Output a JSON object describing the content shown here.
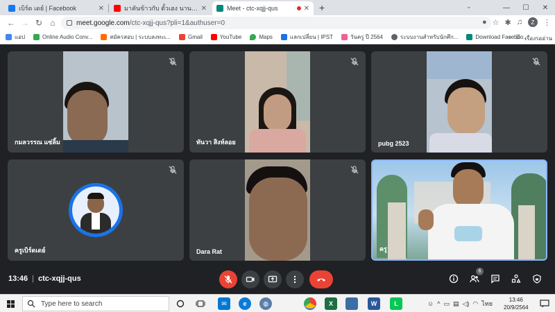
{
  "browser": {
    "tabs": [
      {
        "title": "เบิร์ด เดย์ | Facebook",
        "favicon_color": "#1877f2",
        "active": false
      },
      {
        "title": "มาคันข้าวกับ ตั้วเฮง นานาวิ ประเทศ",
        "favicon_color": "#ff0000",
        "active": false
      },
      {
        "title": "Meet - ctc-xqjj-qus",
        "favicon_color": "#00897b",
        "active": true
      }
    ],
    "new_tab": "+",
    "window_controls": {
      "minimize": "—",
      "maximize": "☐",
      "close": "✕"
    },
    "url_host": "meet.google.com",
    "url_path": "/ctc-xqjj-qus?pli=1&authuser=0",
    "profile_initial": "Z",
    "bookmarks": [
      {
        "label": "แอป",
        "color": "#4285f4"
      },
      {
        "label": "Online Audio Conv...",
        "color": "#34a853"
      },
      {
        "label": "สมัครสอบ | ระบบลงทะเ...",
        "color": "#ff6d00"
      },
      {
        "label": "Gmail",
        "color": "#ea4335"
      },
      {
        "label": "YouTube",
        "color": "#ff0000"
      },
      {
        "label": "Maps",
        "color": "#34a853"
      },
      {
        "label": "แลกเปลี่ยน | IPST",
        "color": "#1a73e8"
      },
      {
        "label": "วันครู ปี 2564",
        "color": "#f06292"
      },
      {
        "label": "ระบบงานสำหรับนักศึก...",
        "color": "#5f6368"
      },
      {
        "label": "Download Faceboo...",
        "color": "#00897b"
      }
    ],
    "bookmarks_more": "»",
    "reading_list": "เรื่องรออ่าน"
  },
  "meet": {
    "participants": [
      {
        "name": "กมลวรรณ แซ่ลิ้ม",
        "muted": true,
        "kind": "video",
        "bg": "#b9c3cb",
        "skin": "#8a6a52",
        "hair": "#1a1410"
      },
      {
        "name": "ทันวา สิงห์ลอย",
        "muted": true,
        "kind": "video",
        "bg": "#c9b9a8",
        "skin": "#c29c82",
        "hair": "#1c1612"
      },
      {
        "name": "pubg 2523",
        "muted": true,
        "kind": "video",
        "bg": "#b7c3cf",
        "skin": "#c4a080",
        "hair": "#151210"
      },
      {
        "name": "ครูเบิร์ดเดย์",
        "muted": true,
        "kind": "avatar",
        "ring": "#1a73e8"
      },
      {
        "name": "Dara Rat",
        "muted": true,
        "kind": "video",
        "bg": "#a39a8c",
        "skin": "#8c6a52",
        "hair": "#141010"
      },
      {
        "name": "ครู",
        "muted": false,
        "kind": "presenter",
        "bg": "#7fb2d8",
        "skin": "#a77a58",
        "hair": "#141010"
      }
    ],
    "meeting_time": "13:46",
    "meeting_code": "ctc-xqjj-qus",
    "people_count": "6"
  },
  "taskbar": {
    "search_placeholder": "Type here to search",
    "apps": [
      {
        "name": "edge",
        "color": "#0c7bd5",
        "glyph": "e"
      },
      {
        "name": "chrome",
        "color": "#ea4335",
        "glyph": ""
      },
      {
        "name": "excel",
        "color": "#1d6f42",
        "glyph": "X"
      },
      {
        "name": "photos",
        "color": "#3b6ea5",
        "glyph": ""
      },
      {
        "name": "word",
        "color": "#2b579a",
        "glyph": "W"
      },
      {
        "name": "line",
        "color": "#06c755",
        "glyph": "L"
      }
    ],
    "lang": "ไทย",
    "time": "13:46",
    "date": "20/9/2564"
  }
}
